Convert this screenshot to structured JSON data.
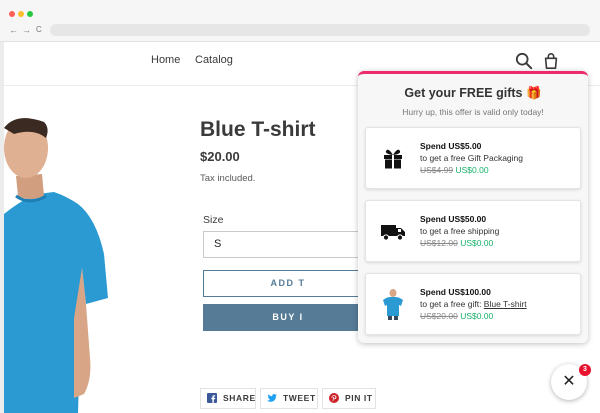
{
  "browser": {
    "back_glyph": "←",
    "forward_glyph": "→",
    "reload_glyph": "C"
  },
  "header": {
    "nav": [
      "Home",
      "Catalog"
    ],
    "icons": [
      "search-icon",
      "cart-icon"
    ]
  },
  "product": {
    "title": "Blue T-shirt",
    "price": "$20.00",
    "tax_note": "Tax included.",
    "size_label": "Size",
    "size_value": "S",
    "add_to_cart": "ADD T",
    "buy_now": "BUY I",
    "image_icon": "tshirt-model-image"
  },
  "share": {
    "facebook": "SHARE",
    "twitter": "TWEET",
    "pinterest": "PIN IT"
  },
  "popup": {
    "title": "Get your FREE gifts",
    "title_icon": "🎁",
    "subtitle": "Hurry up, this offer is valid only today!",
    "accent_color": "#ee2a6f",
    "offers": [
      {
        "icon": "gift-icon",
        "heading": "Spend US$5.00",
        "desc": "to get a free Gift Packaging",
        "desc_link": "",
        "old_price": "US$4.99",
        "new_price": "US$0.00"
      },
      {
        "icon": "truck-icon",
        "heading": "Spend US$50.00",
        "desc": "to get a free shipping",
        "desc_link": "",
        "old_price": "US$12.00",
        "new_price": "US$0.00"
      },
      {
        "icon": "tshirt-icon",
        "heading": "Spend US$100.00",
        "desc": "to get a free gift: ",
        "desc_link": "Blue T-shirt",
        "old_price": "US$20.00",
        "new_price": "US$0.00"
      }
    ]
  },
  "close_button": {
    "glyph": "✕",
    "badge_count": "3"
  },
  "colors": {
    "brand_button": "#557b97",
    "free_price": "#17b26a",
    "badge": "#e8122d"
  }
}
